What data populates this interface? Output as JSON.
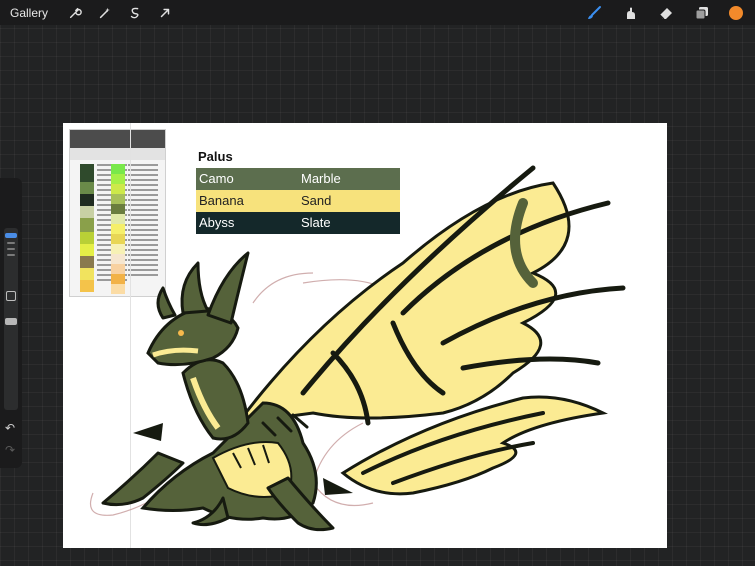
{
  "topbar": {
    "gallery_label": "Gallery",
    "left_tools": [
      {
        "name": "wrench-icon"
      },
      {
        "name": "magic-wand-icon"
      },
      {
        "name": "selection-icon"
      },
      {
        "name": "transform-arrow-icon"
      }
    ],
    "right_tools": [
      {
        "name": "brush-icon",
        "color": "#3b8ff0"
      },
      {
        "name": "smudge-icon",
        "color": "#e0e0e0"
      },
      {
        "name": "eraser-icon",
        "color": "#e0e0e0"
      },
      {
        "name": "layers-icon",
        "color": "#e0e0e0"
      }
    ],
    "current_color": "#f28a2b"
  },
  "sidebar": {
    "undo_icon": "↶",
    "redo_icon": "↷"
  },
  "palette": {
    "title": "Palus",
    "rows": [
      {
        "left": "Camo",
        "right": "Marble",
        "bg": "#5c6e4e",
        "fg": "#ffffff"
      },
      {
        "left": "Banana",
        "right": "Sand",
        "bg": "#f7e27c",
        "fg": "#222222"
      },
      {
        "left": "Abyss",
        "right": "Slate",
        "bg": "#14282a",
        "fg": "#ffffff"
      }
    ]
  },
  "colors": {
    "dragon_body": "#55623a",
    "dragon_wing": "#fbeb93",
    "outline": "#161a10",
    "sketch": "#c59a9a"
  }
}
